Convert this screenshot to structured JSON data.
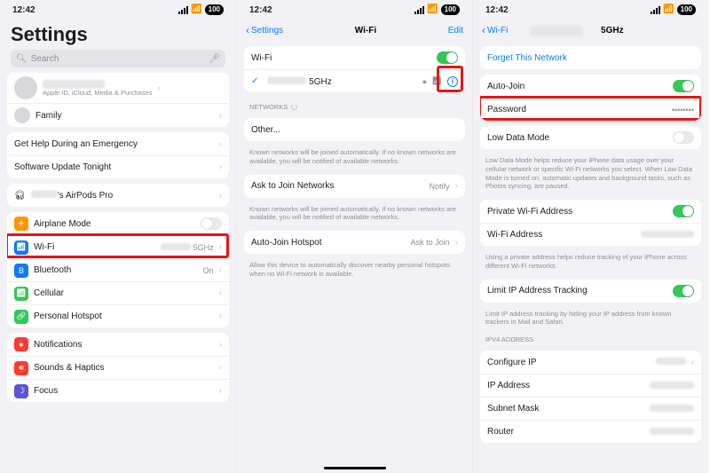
{
  "status": {
    "time": "12:42",
    "battery": "100"
  },
  "panel1": {
    "title": "Settings",
    "search_placeholder": "Search",
    "profile_sub": "Apple ID, iCloud, Media & Purchases",
    "family_label": "Family",
    "emergency_label": "Get Help During an Emergency",
    "update_label": "Software Update Tonight",
    "airpods_label": "'s AirPods Pro",
    "airplane_label": "Airplane Mode",
    "wifi_label": "Wi-Fi",
    "wifi_detail": "5GHz",
    "bluetooth_label": "Bluetooth",
    "bluetooth_detail": "On",
    "cellular_label": "Cellular",
    "hotspot_label": "Personal Hotspot",
    "notifications_label": "Notifications",
    "sounds_label": "Sounds & Haptics",
    "focus_label": "Focus"
  },
  "panel2": {
    "nav_back": "Settings",
    "nav_title": "Wi-Fi",
    "nav_right": "Edit",
    "wifi_toggle_label": "Wi-Fi",
    "connected_suffix": " 5GHz",
    "section_networks": "NETWORKS",
    "other_label": "Other...",
    "other_footer": "Known networks will be joined automatically. If no known networks are available, you will be notified of available networks.",
    "ask_label": "Ask to Join Networks",
    "ask_detail": "Notify",
    "ask_footer": "Known networks will be joined automatically. If no known networks are available, you will be notified of available networks.",
    "autojoin_label": "Auto-Join Hotspot",
    "autojoin_detail": "Ask to Join",
    "autojoin_footer": "Allow this device to automatically discover nearby personal hotspots when no Wi-Fi network is available."
  },
  "panel3": {
    "nav_back": "Wi-Fi",
    "title_suffix": " 5GHz",
    "forget_label": "Forget This Network",
    "autojoin_label": "Auto-Join",
    "password_label": "Password",
    "password_value": "••••••••",
    "lowdata_label": "Low Data Mode",
    "lowdata_footer": "Low Data Mode helps reduce your iPhone data usage over your cellular network or specific Wi-Fi networks you select. When Low Data Mode is turned on, automatic updates and background tasks, such as Photos syncing, are paused.",
    "private_label": "Private Wi-Fi Address",
    "wifi_addr_label": "Wi-Fi Address",
    "private_footer": "Using a private address helps reduce tracking of your iPhone across different Wi-Fi networks.",
    "limit_label": "Limit IP Address Tracking",
    "limit_footer": "Limit IP address tracking by hiding your IP address from known trackers in Mail and Safari.",
    "ipv4_header": "IPV4 ADDRESS",
    "configure_ip_label": "Configure IP",
    "ip_address_label": "IP Address",
    "subnet_label": "Subnet Mask",
    "router_label": "Router"
  }
}
